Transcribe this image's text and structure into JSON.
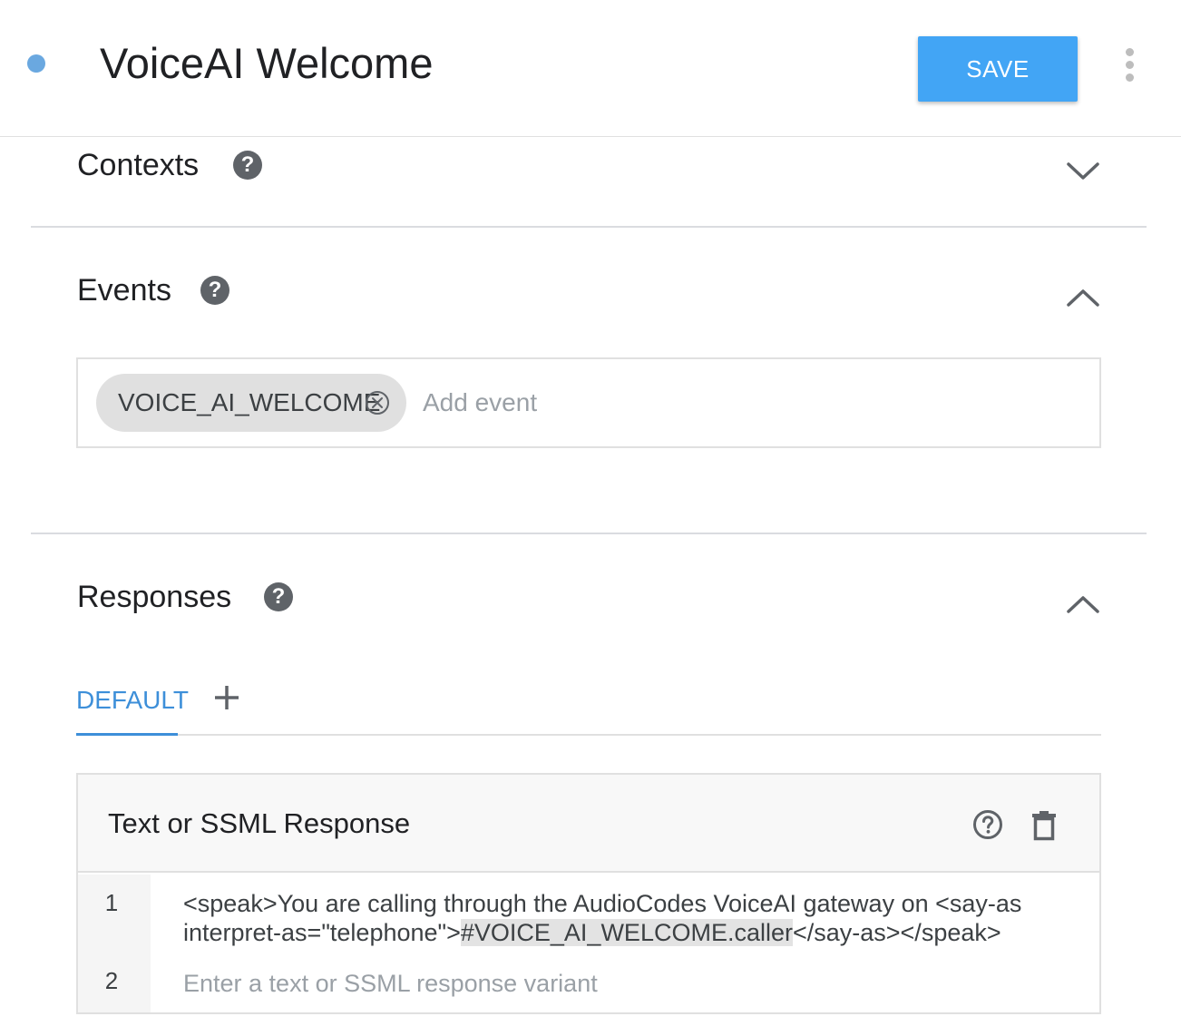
{
  "header": {
    "title": "VoiceAI Welcome",
    "save_label": "SAVE"
  },
  "sections": {
    "contexts": {
      "title": "Contexts",
      "help_glyph": "?",
      "expanded": false
    },
    "events": {
      "title": "Events",
      "help_glyph": "?",
      "expanded": true
    },
    "responses": {
      "title": "Responses",
      "help_glyph": "?",
      "expanded": true
    }
  },
  "events": {
    "chips": [
      "VOICE_AI_WELCOME"
    ],
    "add_placeholder": "Add event"
  },
  "responses": {
    "tabs": [
      {
        "label": "DEFAULT",
        "active": true
      }
    ],
    "card": {
      "title": "Text or SSML Response",
      "rows": [
        {
          "number": "1",
          "text_before": "<speak>You are calling through the AudioCodes VoiceAI gateway on <say-as interpret-as=\"telephone\">",
          "parameter": "#VOICE_AI_WELCOME.caller",
          "text_after": "</say-as></speak>"
        },
        {
          "number": "2",
          "placeholder": "Enter a text or SSML response variant"
        }
      ]
    }
  },
  "icons": {
    "status_dot": "status-dot",
    "more": "more-vert-icon",
    "help": "help-icon",
    "chevron_down": "chevron-down-icon",
    "chevron_up": "chevron-up-icon",
    "chip_close": "close-circle-icon",
    "add_tab": "plus-icon",
    "help_outline": "help-outline-icon",
    "delete": "trash-icon"
  },
  "colors": {
    "accent": "#42a5f5",
    "tab_active": "#3d8fd9",
    "status_dot": "#6aa8e0",
    "chip_bg": "#e0e0e0",
    "param_highlight": "#e3e3e3"
  }
}
